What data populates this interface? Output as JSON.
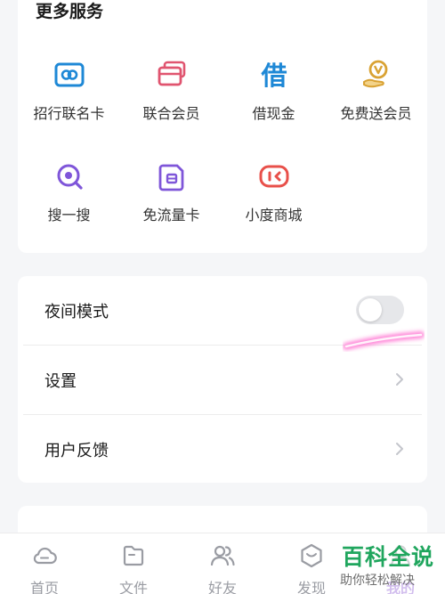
{
  "services": {
    "title": "更多服务",
    "items": [
      {
        "label": "招行联名卡",
        "icon": "credit-card-icon"
      },
      {
        "label": "联合会员",
        "icon": "member-cards-icon"
      },
      {
        "label": "借现金",
        "icon": "borrow-cash-icon"
      },
      {
        "label": "免费送会员",
        "icon": "free-vip-icon"
      },
      {
        "label": "搜一搜",
        "icon": "search-icon"
      },
      {
        "label": "免流量卡",
        "icon": "data-card-icon"
      },
      {
        "label": "小度商城",
        "icon": "xiaodu-store-icon"
      }
    ],
    "borrow_glyph": "借"
  },
  "settings": {
    "night_mode": {
      "label": "夜间模式",
      "enabled": false
    },
    "settings_label": "设置",
    "feedback_label": "用户反馈"
  },
  "tabbar": {
    "tabs": [
      {
        "label": "首页",
        "icon": "cloud-icon"
      },
      {
        "label": "文件",
        "icon": "folder-icon"
      },
      {
        "label": "好友",
        "icon": "friends-icon"
      },
      {
        "label": "发现",
        "icon": "discover-icon"
      },
      {
        "label": "我的",
        "icon": "profile-icon"
      }
    ]
  },
  "watermark": {
    "title": "百科全说",
    "subtitle": "助你轻松解决"
  },
  "colors": {
    "blue": "#1e88d6",
    "pink": "#e0546f",
    "gold": "#d9a233",
    "purple": "#7f56d9",
    "red": "#e8504a",
    "tab_gray": "#9a9ca3",
    "watermark_green": "#20a65e"
  }
}
